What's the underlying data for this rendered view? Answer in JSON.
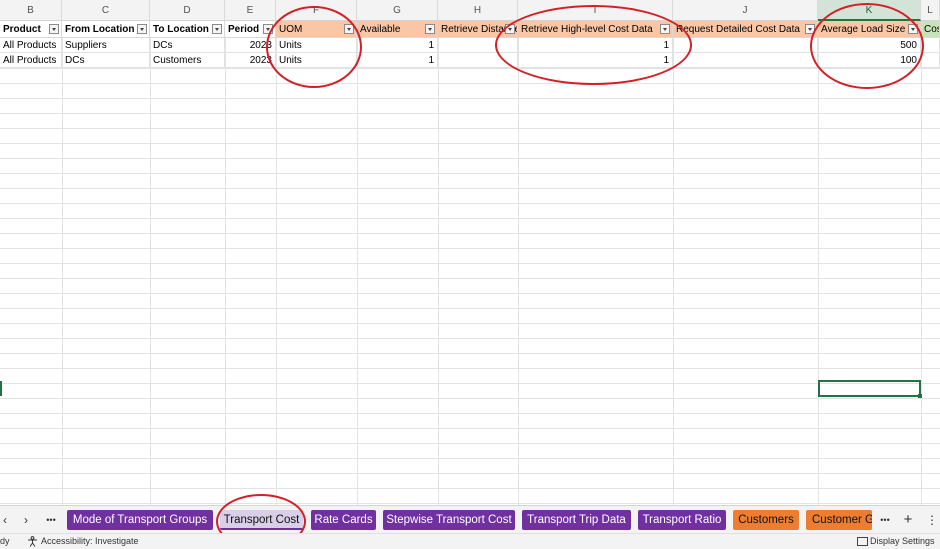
{
  "columns": [
    {
      "letter": "B",
      "header": "Product",
      "style": "bold"
    },
    {
      "letter": "C",
      "header": "From Location",
      "style": "bold"
    },
    {
      "letter": "D",
      "header": "To Location",
      "style": "bold"
    },
    {
      "letter": "E",
      "header": "Period",
      "style": "bold"
    },
    {
      "letter": "F",
      "header": "UOM",
      "style": "orange"
    },
    {
      "letter": "G",
      "header": "Available",
      "style": "orange"
    },
    {
      "letter": "H",
      "header": "Retrieve Distances",
      "style": "orange"
    },
    {
      "letter": "I",
      "header": "Retrieve High-level Cost Data",
      "style": "orange"
    },
    {
      "letter": "J",
      "header": "Request Detailed Cost Data",
      "style": "orange"
    },
    {
      "letter": "K",
      "header": "Average Load Size",
      "style": "orange"
    },
    {
      "letter": "L",
      "header": "Cost",
      "style": "green"
    }
  ],
  "rows": [
    [
      "All Products",
      "Suppliers",
      "DCs",
      "2023",
      "Units",
      "1",
      "",
      "1",
      "",
      "500",
      ""
    ],
    [
      "All Products",
      "DCs",
      "Customers",
      "2023",
      "Units",
      "1",
      "",
      "1",
      "",
      "100",
      ""
    ]
  ],
  "selected_column": "K",
  "tabs": {
    "nav_prev": "‹",
    "nav_next": "›",
    "more": "•••",
    "add": "+",
    "more_right": "⋮",
    "items": [
      {
        "label": "Mode of Transport Groups",
        "color": "purple"
      },
      {
        "label": "Transport Cost",
        "color": "active"
      },
      {
        "label": "Rate Cards",
        "color": "purple"
      },
      {
        "label": "Stepwise Transport Cost",
        "color": "purple"
      },
      {
        "label": "Transport Trip Data",
        "color": "purple"
      },
      {
        "label": "Transport Ratio",
        "color": "purple"
      },
      {
        "label": "Customers",
        "color": "orange"
      },
      {
        "label": "Customer Gr",
        "color": "orange"
      }
    ]
  },
  "status": {
    "ready": "dy",
    "accessibility": "Accessibility: Investigate",
    "display_settings": "Display Settings"
  },
  "colors": {
    "header_orange": "#f9c7a6",
    "header_green": "#c9e3b9",
    "tab_purple": "#7030a0",
    "tab_orange": "#ed7d31",
    "annotation_red": "#d41f26",
    "selection_green": "#217346"
  }
}
